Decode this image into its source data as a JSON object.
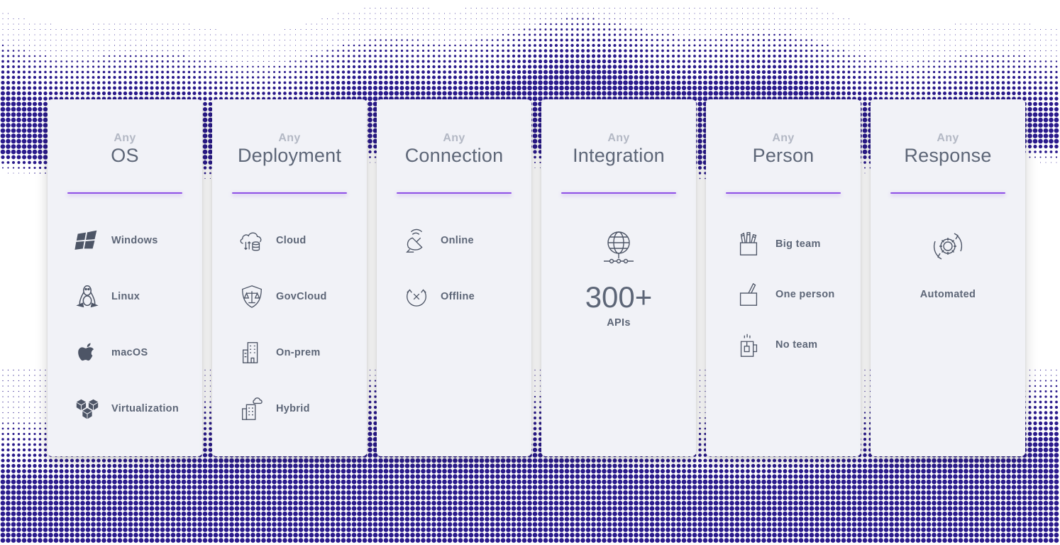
{
  "colors": {
    "dots": "#2a1a8c",
    "card": "#f1f2f7",
    "accent": "#8e4fe6",
    "text": "#5d6677",
    "muted": "#b3b8c4"
  },
  "cards": [
    {
      "any": "Any",
      "title": "OS",
      "items": [
        {
          "icon": "windows-icon",
          "label": "Windows"
        },
        {
          "icon": "linux-icon",
          "label": "Linux"
        },
        {
          "icon": "apple-icon",
          "label": "macOS"
        },
        {
          "icon": "virtualization-icon",
          "label": "Virtualization"
        }
      ]
    },
    {
      "any": "Any",
      "title": "Deployment",
      "items": [
        {
          "icon": "cloud-database-icon",
          "label": "Cloud"
        },
        {
          "icon": "shield-scales-icon",
          "label": "GovCloud"
        },
        {
          "icon": "building-icon",
          "label": "On-prem"
        },
        {
          "icon": "building-cloud-icon",
          "label": "Hybrid"
        }
      ]
    },
    {
      "any": "Any",
      "title": "Connection",
      "items": [
        {
          "icon": "satellite-dish-icon",
          "label": "Online"
        },
        {
          "icon": "disconnected-icon",
          "label": "Offline"
        }
      ]
    },
    {
      "any": "Any",
      "title": "Integration",
      "icon": "globe-network-icon",
      "number": "300+",
      "sub": "APIs"
    },
    {
      "any": "Any",
      "title": "Person",
      "items": [
        {
          "icon": "pencil-cup-icon",
          "label": "Big team"
        },
        {
          "icon": "single-pencil-cup-icon",
          "label": "One person"
        },
        {
          "icon": "mug-icon",
          "label": "No team"
        }
      ]
    },
    {
      "any": "Any",
      "title": "Response",
      "icon": "gear-cycle-icon",
      "label": "Automated"
    }
  ]
}
